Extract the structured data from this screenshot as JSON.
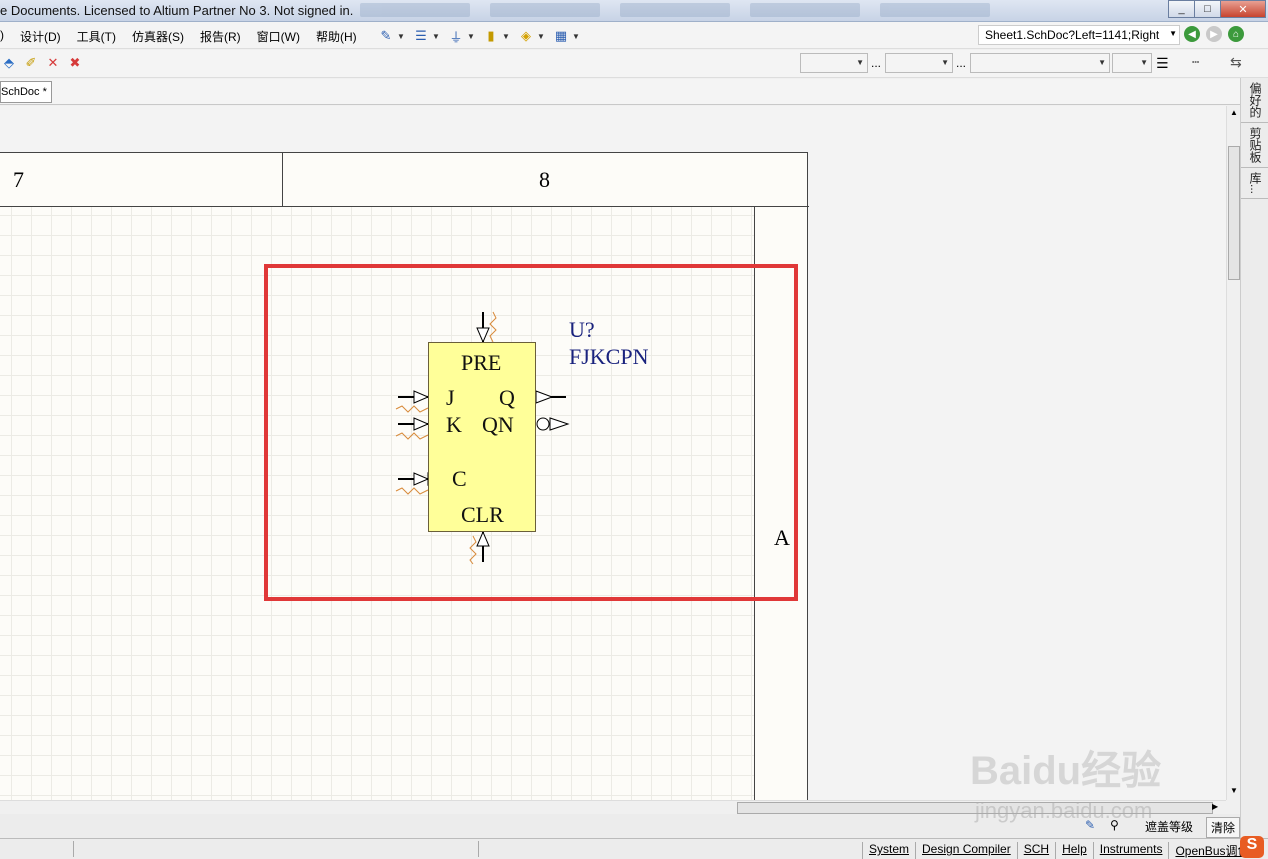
{
  "title_bar": {
    "text": "e Documents. Licensed to Altium Partner No 3. Not signed in.",
    "buttons": [
      "_",
      "□",
      "✕"
    ]
  },
  "menu": {
    "items": [
      ")",
      "设计(D)",
      "工具(T)",
      "仿真器(S)",
      "报告(R)",
      "窗口(W)",
      "帮助(H)"
    ]
  },
  "nav": {
    "address": "Sheet1.SchDoc?Left=1141;Right"
  },
  "toolbar2": {
    "dots": "..."
  },
  "doc_tab": {
    "label": "SchDoc *"
  },
  "side_panel": {
    "labels": [
      "偏好的",
      "剪贴板",
      "库..."
    ]
  },
  "sheet": {
    "zone_7": "7",
    "zone_8": "8",
    "zone_A": "A"
  },
  "component": {
    "designator": "U?",
    "comment": "FJKCPN",
    "pins": {
      "pre": "PRE",
      "j": "J",
      "q": "Q",
      "k": "K",
      "qn": "QN",
      "c": "C",
      "clr": "CLR"
    },
    "fill_color": "#ffff99",
    "text_color": "#1a237e"
  },
  "highlight": {
    "color": "#e03838"
  },
  "bottom": {
    "mask_label": "遮盖等级",
    "clear_label": "清除"
  },
  "status_bar": {
    "items": [
      "System",
      "Design Compiler",
      "SCH",
      "Help",
      "Instruments",
      "OpenBus调色板"
    ]
  },
  "watermark": {
    "main": "Baidu经验",
    "url": "jingyan.baidu.com"
  }
}
